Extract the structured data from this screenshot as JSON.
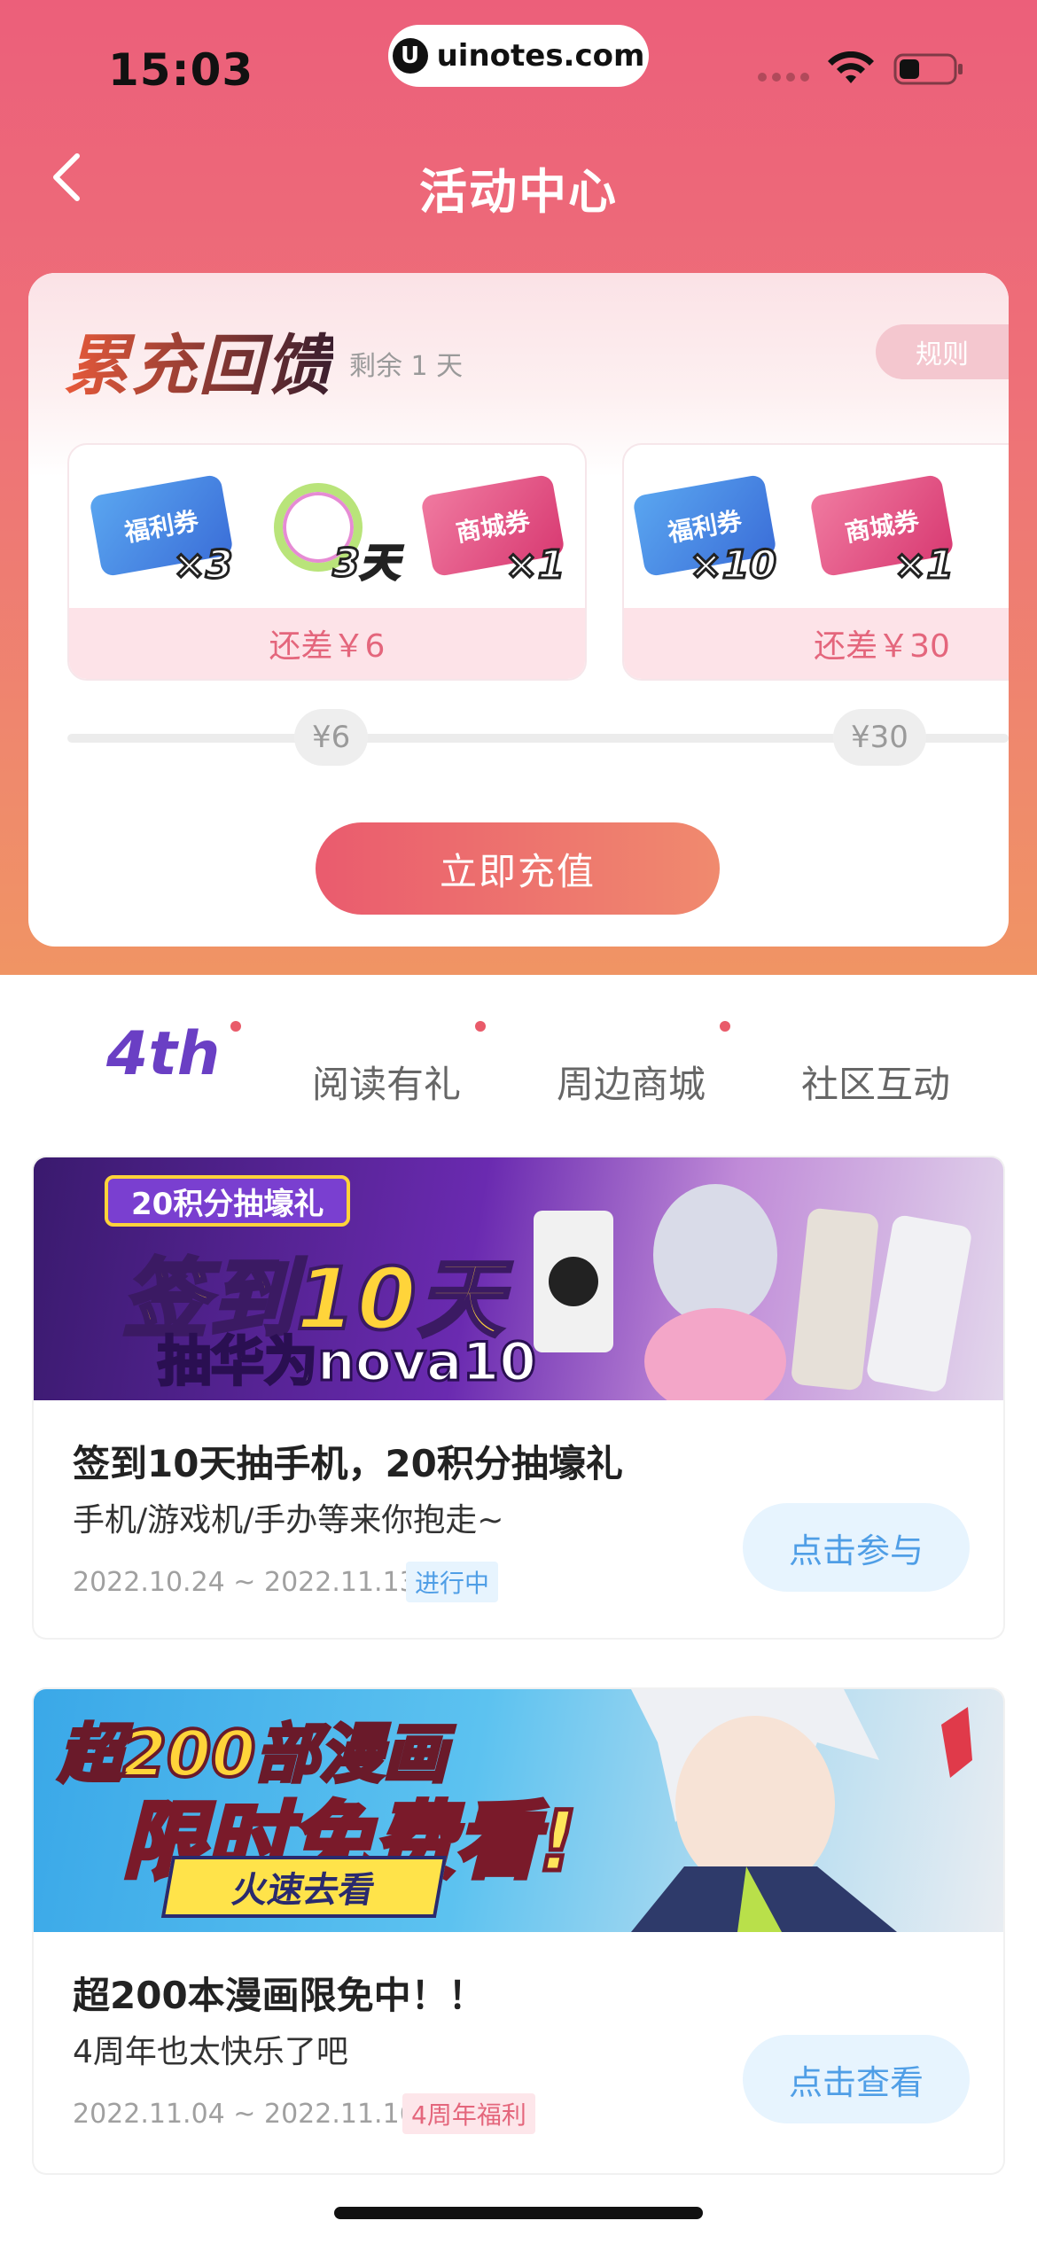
{
  "status_bar": {
    "time": "15:03",
    "url": "uinotes.com",
    "url_logo": "U"
  },
  "nav": {
    "title": "活动中心"
  },
  "recharge": {
    "title": "累充回馈",
    "remaining": "剩余 1 天",
    "rule_label": "规则",
    "tiers": [
      {
        "rewards": [
          {
            "icon": "welfare-coupon-icon",
            "name": "福利券",
            "qty": "×3",
            "style": "blue"
          },
          {
            "icon": "avatar-frame-icon",
            "name": "",
            "qty": "3天",
            "style": "wreath"
          },
          {
            "icon": "mall-coupon-icon",
            "name": "商城券",
            "qty": "×1",
            "style": "pink"
          }
        ],
        "footer": "还差￥6"
      },
      {
        "rewards": [
          {
            "icon": "welfare-coupon-icon",
            "name": "福利券",
            "qty": "×10",
            "style": "blue"
          },
          {
            "icon": "mall-coupon-icon",
            "name": "商城券",
            "qty": "×1",
            "style": "pink"
          }
        ],
        "footer": "还差￥30"
      }
    ],
    "milestones": [
      "¥6",
      "¥30"
    ],
    "button_label": "立即充值"
  },
  "tabs": {
    "logo_text": "4th",
    "items": [
      "阅读有礼",
      "周边商城",
      "社区互动"
    ]
  },
  "activities": [
    {
      "banner_tag": "20积分抽壕礼",
      "banner_big": "签到10天",
      "banner_sub": "抽华为nova10",
      "title": "签到10天抽手机，20积分抽壕礼",
      "desc": "手机/游戏机/手办等来你抱走~",
      "date": "2022.10.24 ~ 2022.11.13",
      "badge": "进行中",
      "badge_color": "#4f9ee6",
      "badge_bg": "#e7f4fe",
      "button": "点击参与"
    },
    {
      "banner_title": "超200部漫画",
      "banner_sub": "限时免费看!",
      "banner_btn": "火速去看",
      "title": "超200本漫画限免中！！",
      "desc": "4周年也太快乐了吧",
      "date": "2022.11.04 ~ 2022.11.16",
      "badge": "4周年福利",
      "badge_color": "#e4667c",
      "badge_bg": "#fde6ea",
      "button": "点击查看"
    }
  ],
  "colors": {
    "accent_pink": "#ec5f7a",
    "button_blue": "#4f9ee6"
  }
}
